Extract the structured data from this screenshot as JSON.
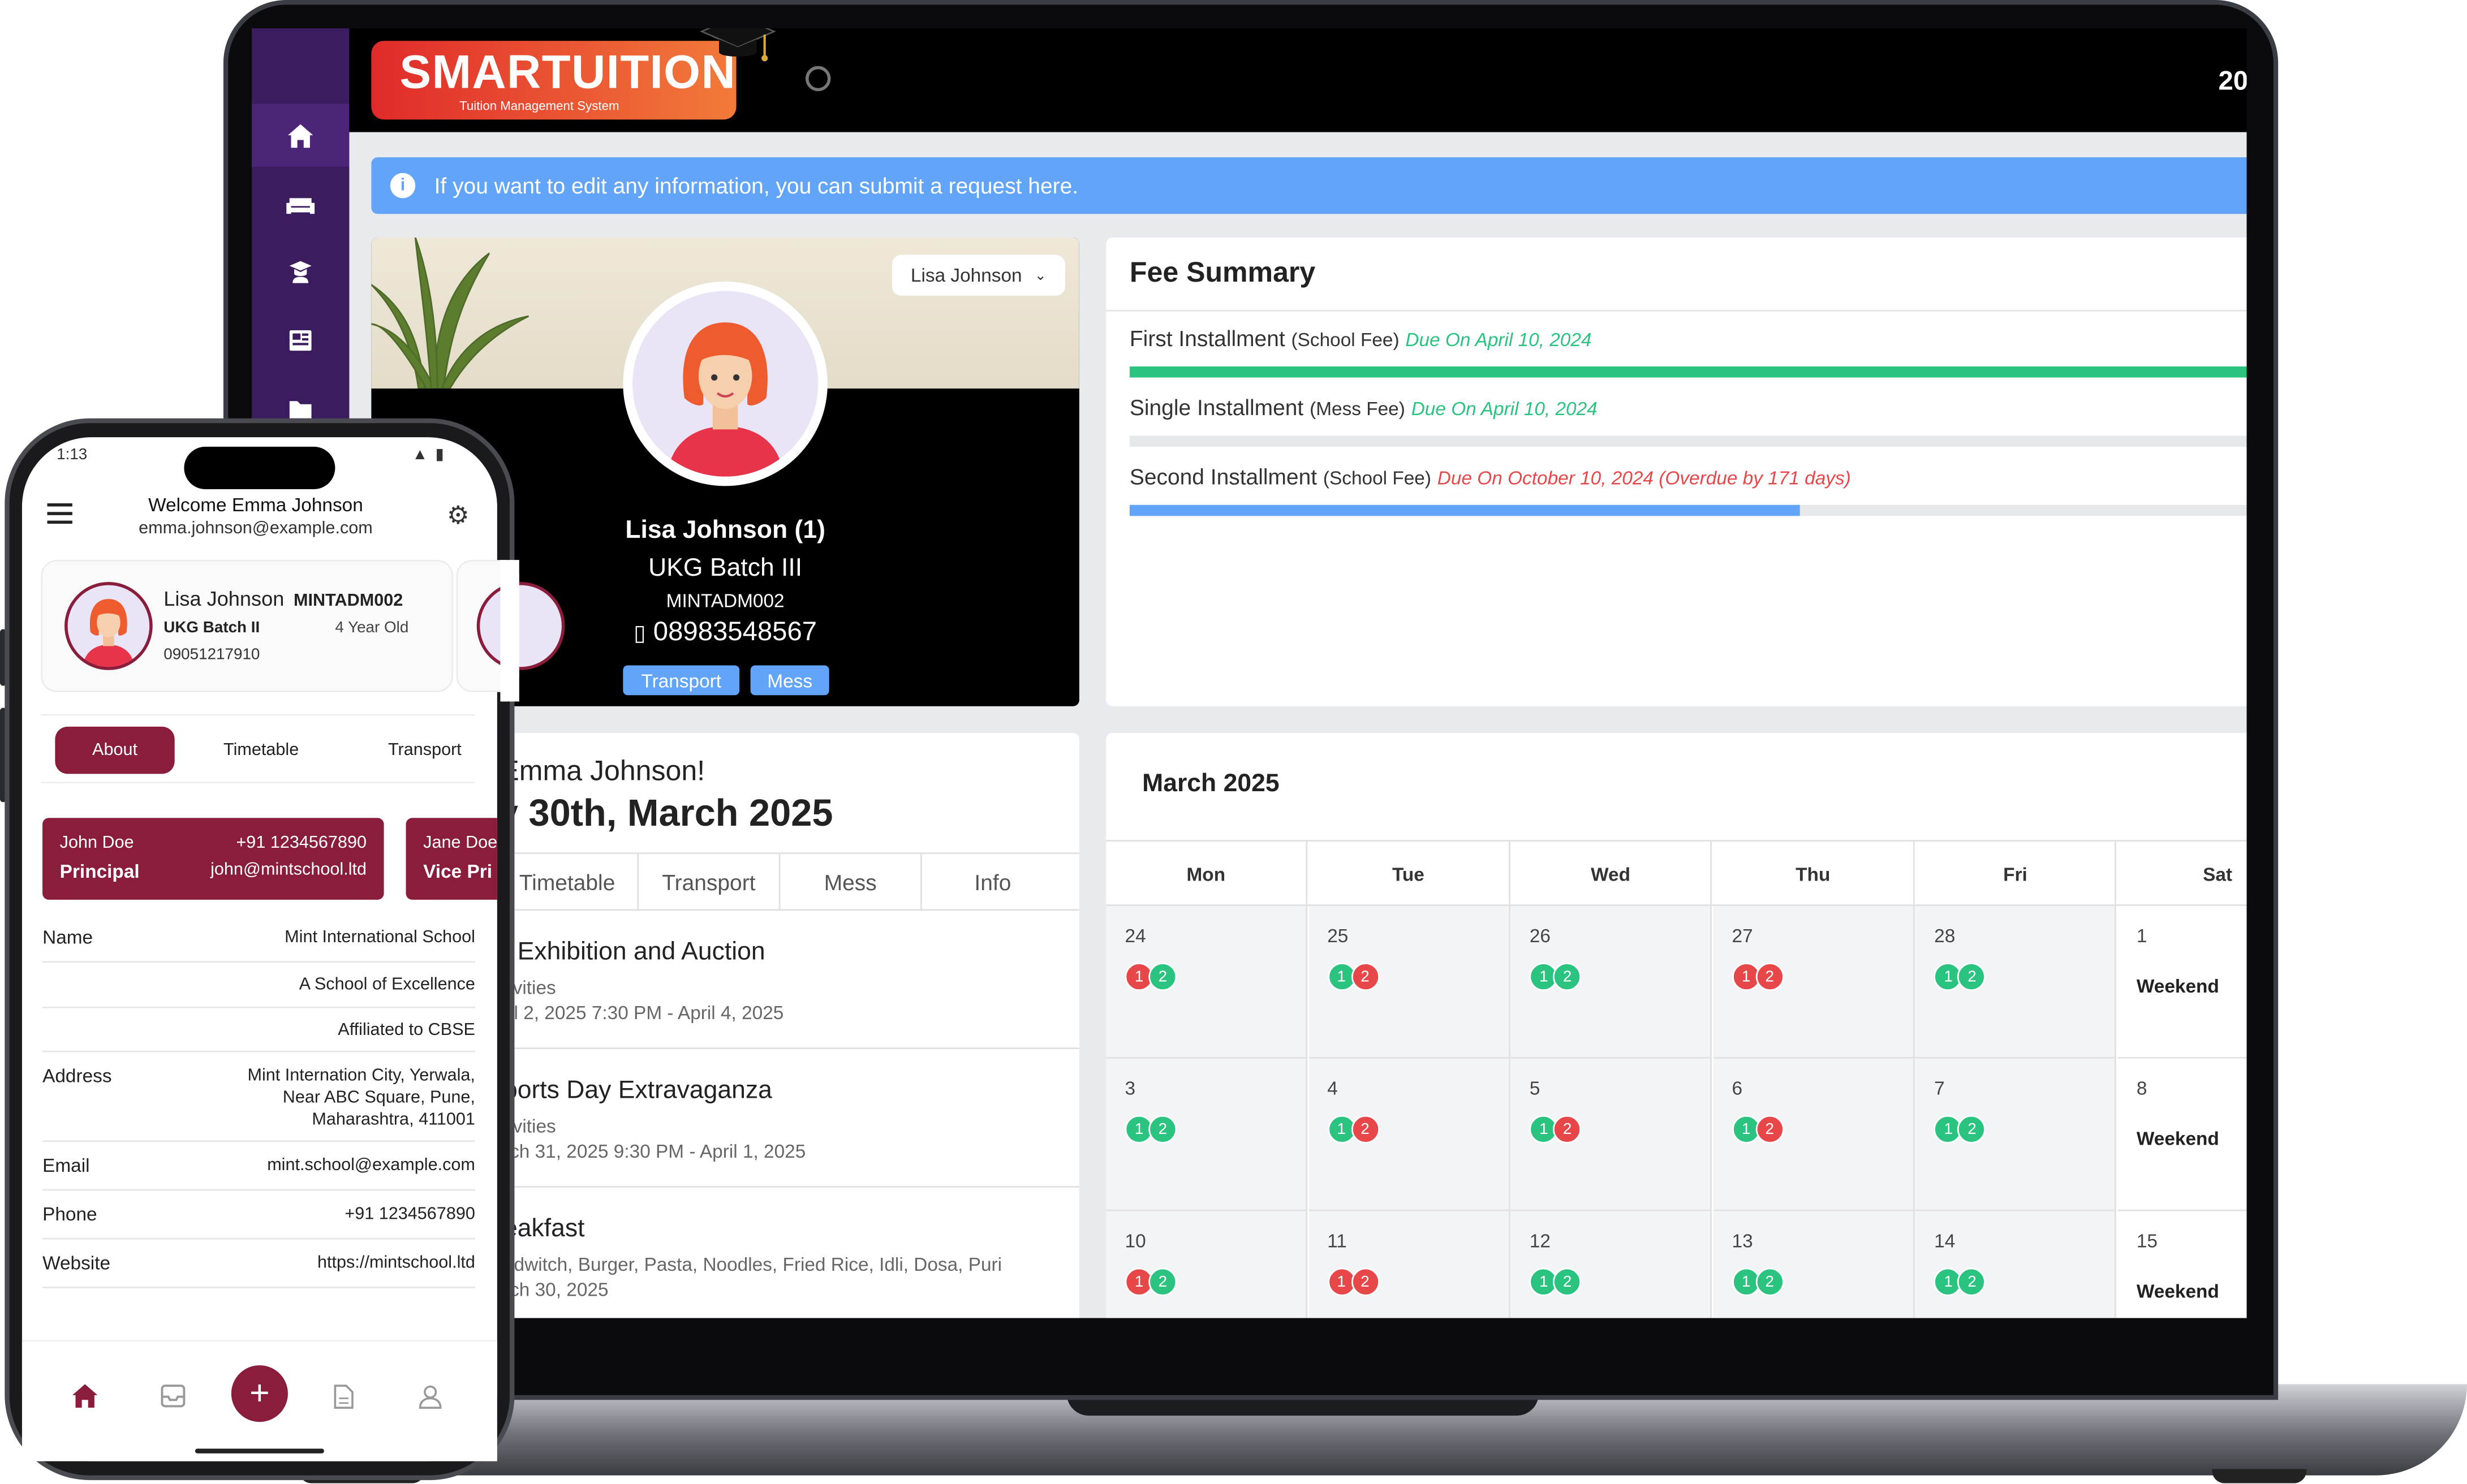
{
  "brand": {
    "logo_title": "SMARTUITION",
    "logo_subtitle": "Tuition Management System",
    "top_number": "20"
  },
  "sidebar": {
    "items": [
      {
        "icon": "home-icon"
      },
      {
        "icon": "sofa-icon"
      },
      {
        "icon": "student-icon"
      },
      {
        "icon": "newspaper-icon"
      },
      {
        "icon": "folder-icon"
      }
    ]
  },
  "alert": {
    "text": "If you want to edit any information, you can submit a request here."
  },
  "profile": {
    "selector": "Lisa Johnson",
    "name": "Lisa Johnson (1)",
    "batch": "UKG Batch III",
    "admission": "MINTADM002",
    "phone": "08983548567",
    "tags": [
      "Transport",
      "Mess"
    ]
  },
  "fee": {
    "title": "Fee Summary",
    "items": [
      {
        "name": "First Installment",
        "type": "(School Fee)",
        "due": "Due On April 10, 2024",
        "status": "paid",
        "progress": 1.0,
        "color": "#2ac380"
      },
      {
        "name": "Single Installment",
        "type": "(Mess Fee)",
        "due": "Due On April 10, 2024",
        "status": "pending",
        "progress": 0.0,
        "color": "#2ac380"
      },
      {
        "name": "Second Installment",
        "type": "(School Fee)",
        "due": "Due On October 10, 2024 (Overdue by 171 days)",
        "status": "overdue",
        "progress": 0.6,
        "color": "#62a5f8"
      }
    ]
  },
  "events": {
    "greeting": "Emma Johnson!",
    "date": "y 30th, March 2025",
    "tabs": [
      "Timetable",
      "Transport",
      "Mess",
      "Info"
    ],
    "items": [
      {
        "title": "t Exhibition and Auction",
        "category": "tivities",
        "dates": "ril 2, 2025 7:30 PM - April 4, 2025"
      },
      {
        "title": "ports Day Extravaganza",
        "category": "tivities",
        "dates": "rch 31, 2025 9:30 PM - April 1, 2025"
      },
      {
        "title": "eakfast",
        "category": "ndwitch, Burger, Pasta, Noodles, Fried Rice, Idli, Dosa, Puri",
        "dates": "rch 30, 2025"
      }
    ]
  },
  "calendar": {
    "title": "March 2025",
    "days": [
      "Mon",
      "Tue",
      "Wed",
      "Thu",
      "Fri",
      "Sat"
    ],
    "weekend_label": "Weekend",
    "weeks": [
      [
        {
          "d": "24",
          "a": "r",
          "b": "g"
        },
        {
          "d": "25",
          "a": "g",
          "b": "r"
        },
        {
          "d": "26",
          "a": "g",
          "b": "g"
        },
        {
          "d": "27",
          "a": "r",
          "b": "r"
        },
        {
          "d": "28",
          "a": "g",
          "b": "g"
        },
        {
          "d": "1",
          "w": true
        }
      ],
      [
        {
          "d": "3",
          "a": "g",
          "b": "g"
        },
        {
          "d": "4",
          "a": "g",
          "b": "r"
        },
        {
          "d": "5",
          "a": "g",
          "b": "r"
        },
        {
          "d": "6",
          "a": "g",
          "b": "r"
        },
        {
          "d": "7",
          "a": "g",
          "b": "g"
        },
        {
          "d": "8",
          "w": true
        }
      ],
      [
        {
          "d": "10",
          "a": "r",
          "b": "g"
        },
        {
          "d": "11",
          "a": "r",
          "b": "r"
        },
        {
          "d": "12",
          "a": "g",
          "b": "g"
        },
        {
          "d": "13",
          "a": "g",
          "b": "g"
        },
        {
          "d": "14",
          "a": "g",
          "b": "g"
        },
        {
          "d": "15",
          "w": true
        }
      ]
    ]
  },
  "phone": {
    "status_time": "1:13",
    "welcome": "Welcome Emma Johnson",
    "email": "emma.johnson@example.com",
    "student": {
      "name": "Lisa Johnson",
      "adm": "MINTADM002",
      "batch": "UKG Batch II",
      "age": "4 Year Old",
      "phone": "09051217910"
    },
    "tabs": [
      "About",
      "Timetable",
      "Transport"
    ],
    "staff": [
      {
        "name": "John Doe",
        "role": "Principal",
        "phone": "+91 1234567890",
        "email": "john@mintschool.ltd"
      },
      {
        "name": "Jane Doe",
        "role": "Vice Pri"
      }
    ],
    "info": [
      {
        "key": "Name",
        "value": "Mint International School"
      },
      {
        "key": "",
        "value": "A School of Excellence"
      },
      {
        "key": "",
        "value": "Affiliated to CBSE"
      },
      {
        "key": "Address",
        "value": "Mint Internation City, Yerwala, Near ABC Square, Pune, Maharashtra, 411001"
      },
      {
        "key": "Email",
        "value": "mint.school@example.com"
      },
      {
        "key": "Phone",
        "value": "+91 1234567890"
      },
      {
        "key": "Website",
        "value": "https://mintschool.ltd"
      }
    ]
  },
  "colors": {
    "brand": "#8a1d3c",
    "sidebar": "#3b1c5e",
    "info": "#62a5f8",
    "green": "#2ac380",
    "red": "#e8474a"
  }
}
